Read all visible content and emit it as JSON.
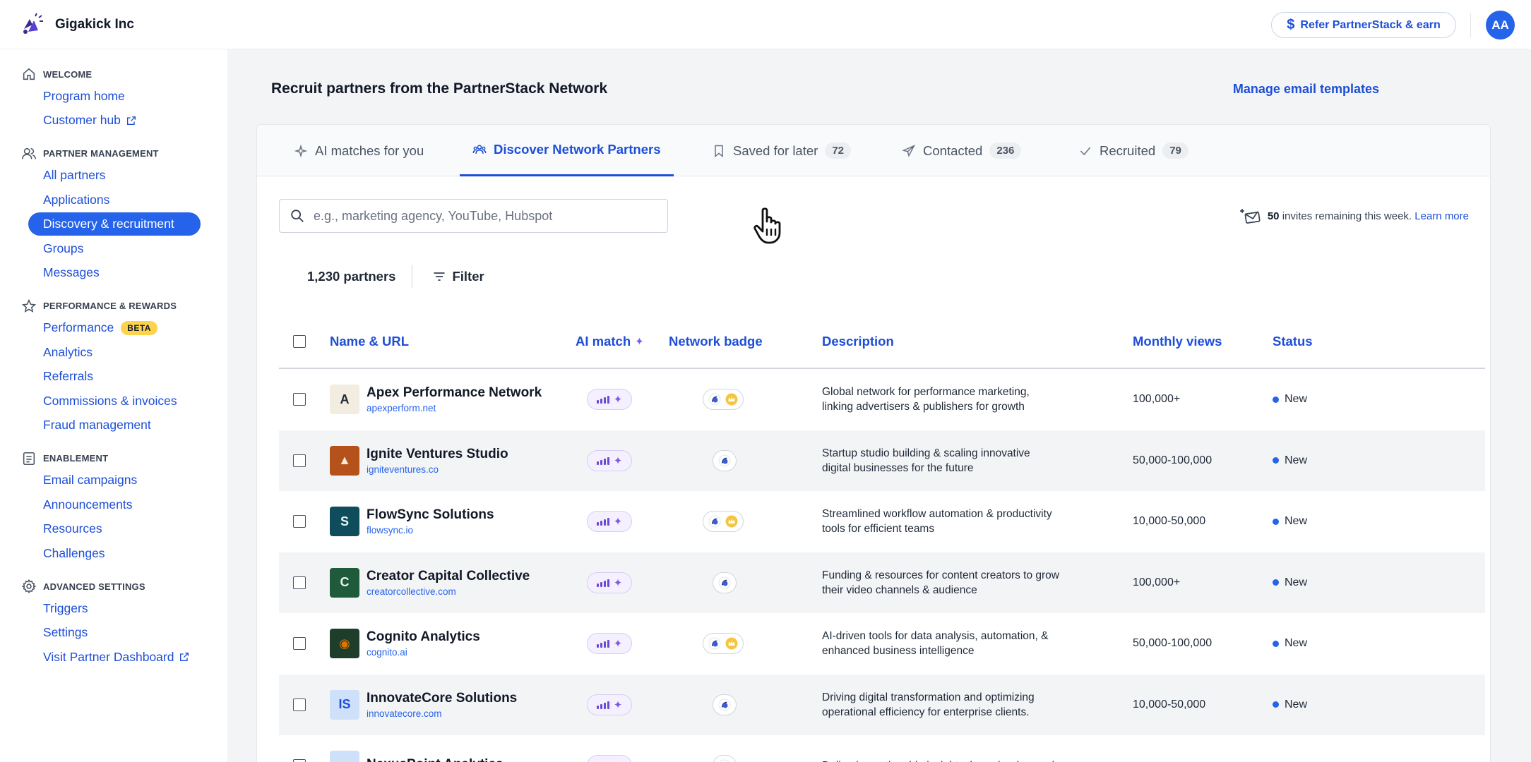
{
  "app": {
    "company_name": "Gigakick Inc",
    "refer_label": "Refer PartnerStack & earn",
    "avatar_initials": "AA"
  },
  "sidebar": {
    "sections": [
      {
        "title": "WELCOME",
        "icon": "home-icon",
        "items": [
          {
            "label": "Program home"
          },
          {
            "label": "Customer hub",
            "external": true
          }
        ]
      },
      {
        "title": "PARTNER MANAGEMENT",
        "icon": "users-icon",
        "items": [
          {
            "label": "All partners"
          },
          {
            "label": "Applications"
          },
          {
            "label": "Discovery & recruitment",
            "active": true
          },
          {
            "label": "Groups"
          },
          {
            "label": "Messages"
          }
        ]
      },
      {
        "title": "PERFORMANCE & REWARDS",
        "icon": "star-icon",
        "items": [
          {
            "label": "Performance",
            "badge": "BETA"
          },
          {
            "label": "Analytics"
          },
          {
            "label": "Referrals"
          },
          {
            "label": "Commissions & invoices"
          },
          {
            "label": "Fraud management"
          }
        ]
      },
      {
        "title": "ENABLEMENT",
        "icon": "document-icon",
        "items": [
          {
            "label": "Email campaigns"
          },
          {
            "label": "Announcements"
          },
          {
            "label": "Resources"
          },
          {
            "label": "Challenges"
          }
        ]
      },
      {
        "title": "ADVANCED SETTINGS",
        "icon": "gear-icon",
        "items": [
          {
            "label": "Triggers"
          },
          {
            "label": "Settings"
          },
          {
            "label": "Visit Partner Dashboard",
            "external": true
          }
        ]
      }
    ]
  },
  "main": {
    "title": "Recruit partners from the PartnerStack Network",
    "manage_link": "Manage email templates",
    "tabs": [
      {
        "label": "AI matches for you"
      },
      {
        "label": "Discover Network Partners",
        "active": true
      },
      {
        "label": "Saved for later",
        "count": "72"
      },
      {
        "label": "Contacted",
        "count": "236"
      },
      {
        "label": "Recruited",
        "count": "79"
      }
    ],
    "search": {
      "placeholder": "e.g., marketing agency, YouTube, Hubspot",
      "value": ""
    },
    "invites": {
      "count": "50",
      "text": "invites remaining this week.",
      "link": "Learn more"
    },
    "partner_count": "1,230 partners",
    "filter_label": "Filter",
    "columns": [
      "Name & URL",
      "AI match",
      "Network badge",
      "Description",
      "Monthly views",
      "Status"
    ],
    "rows": [
      {
        "name": "Apex Performance Network",
        "url": "apexperform.net",
        "logo_text": "A",
        "logo_bg": "#f3ede1",
        "logo_color": "#1f2937",
        "badge_count": 2,
        "desc1": "Global network for performance marketing,",
        "desc2": "linking advertisers & publishers for growth",
        "views": "100,000+",
        "status": "New"
      },
      {
        "name": "Ignite Ventures Studio",
        "url": "igniteventures.co",
        "logo_text": "▲",
        "logo_bg": "#b5521c",
        "logo_color": "#fde7d3",
        "badge_count": 1,
        "desc1": "Startup studio building & scaling innovative",
        "desc2": "digital businesses for the future",
        "views": "50,000-100,000",
        "status": "New"
      },
      {
        "name": "FlowSync Solutions",
        "url": "flowsync.io",
        "logo_text": "S",
        "logo_bg": "#0f4c5c",
        "logo_color": "#e5f4f7",
        "badge_count": 2,
        "desc1": "Streamlined workflow automation & productivity",
        "desc2": "tools for efficient teams",
        "views": "10,000-50,000",
        "status": "New"
      },
      {
        "name": "Creator Capital Collective",
        "url": "creatorcollective.com",
        "logo_text": "C",
        "logo_bg": "#1f5a3a",
        "logo_color": "#e6f4ea",
        "badge_count": 1,
        "desc1": "Funding & resources for content creators to grow",
        "desc2": "their video channels & audience",
        "views": "100,000+",
        "status": "New"
      },
      {
        "name": "Cognito Analytics",
        "url": "cognito.ai",
        "logo_text": "◉",
        "logo_bg": "#1f3d2b",
        "logo_color": "#d97706",
        "badge_count": 2,
        "desc1": "AI-driven tools for data analysis, automation, &",
        "desc2": "enhanced business intelligence",
        "views": "50,000-100,000",
        "status": "New"
      },
      {
        "name": "InnovateCore Solutions",
        "url": "innovatecore.com",
        "logo_text": "IS",
        "logo_bg": "#cfe0fb",
        "logo_color": "#1d4ed8",
        "badge_count": 1,
        "desc1": "Driving digital transformation and optimizing",
        "desc2": "operational efficiency for enterprise clients.",
        "views": "10,000-50,000",
        "status": "New"
      },
      {
        "name": "NexusPoint Analytics",
        "url": "",
        "logo_text": "",
        "logo_bg": "#cfe0fb",
        "logo_color": "#1d4ed8",
        "badge_count": 1,
        "desc1": "Delivering actionable insights through advanced",
        "desc2": "",
        "views": "",
        "status": ""
      }
    ]
  },
  "colors": {
    "accent": "#2563eb",
    "ai_purple": "#6d48d6",
    "beta_yellow": "#fcd34d"
  }
}
